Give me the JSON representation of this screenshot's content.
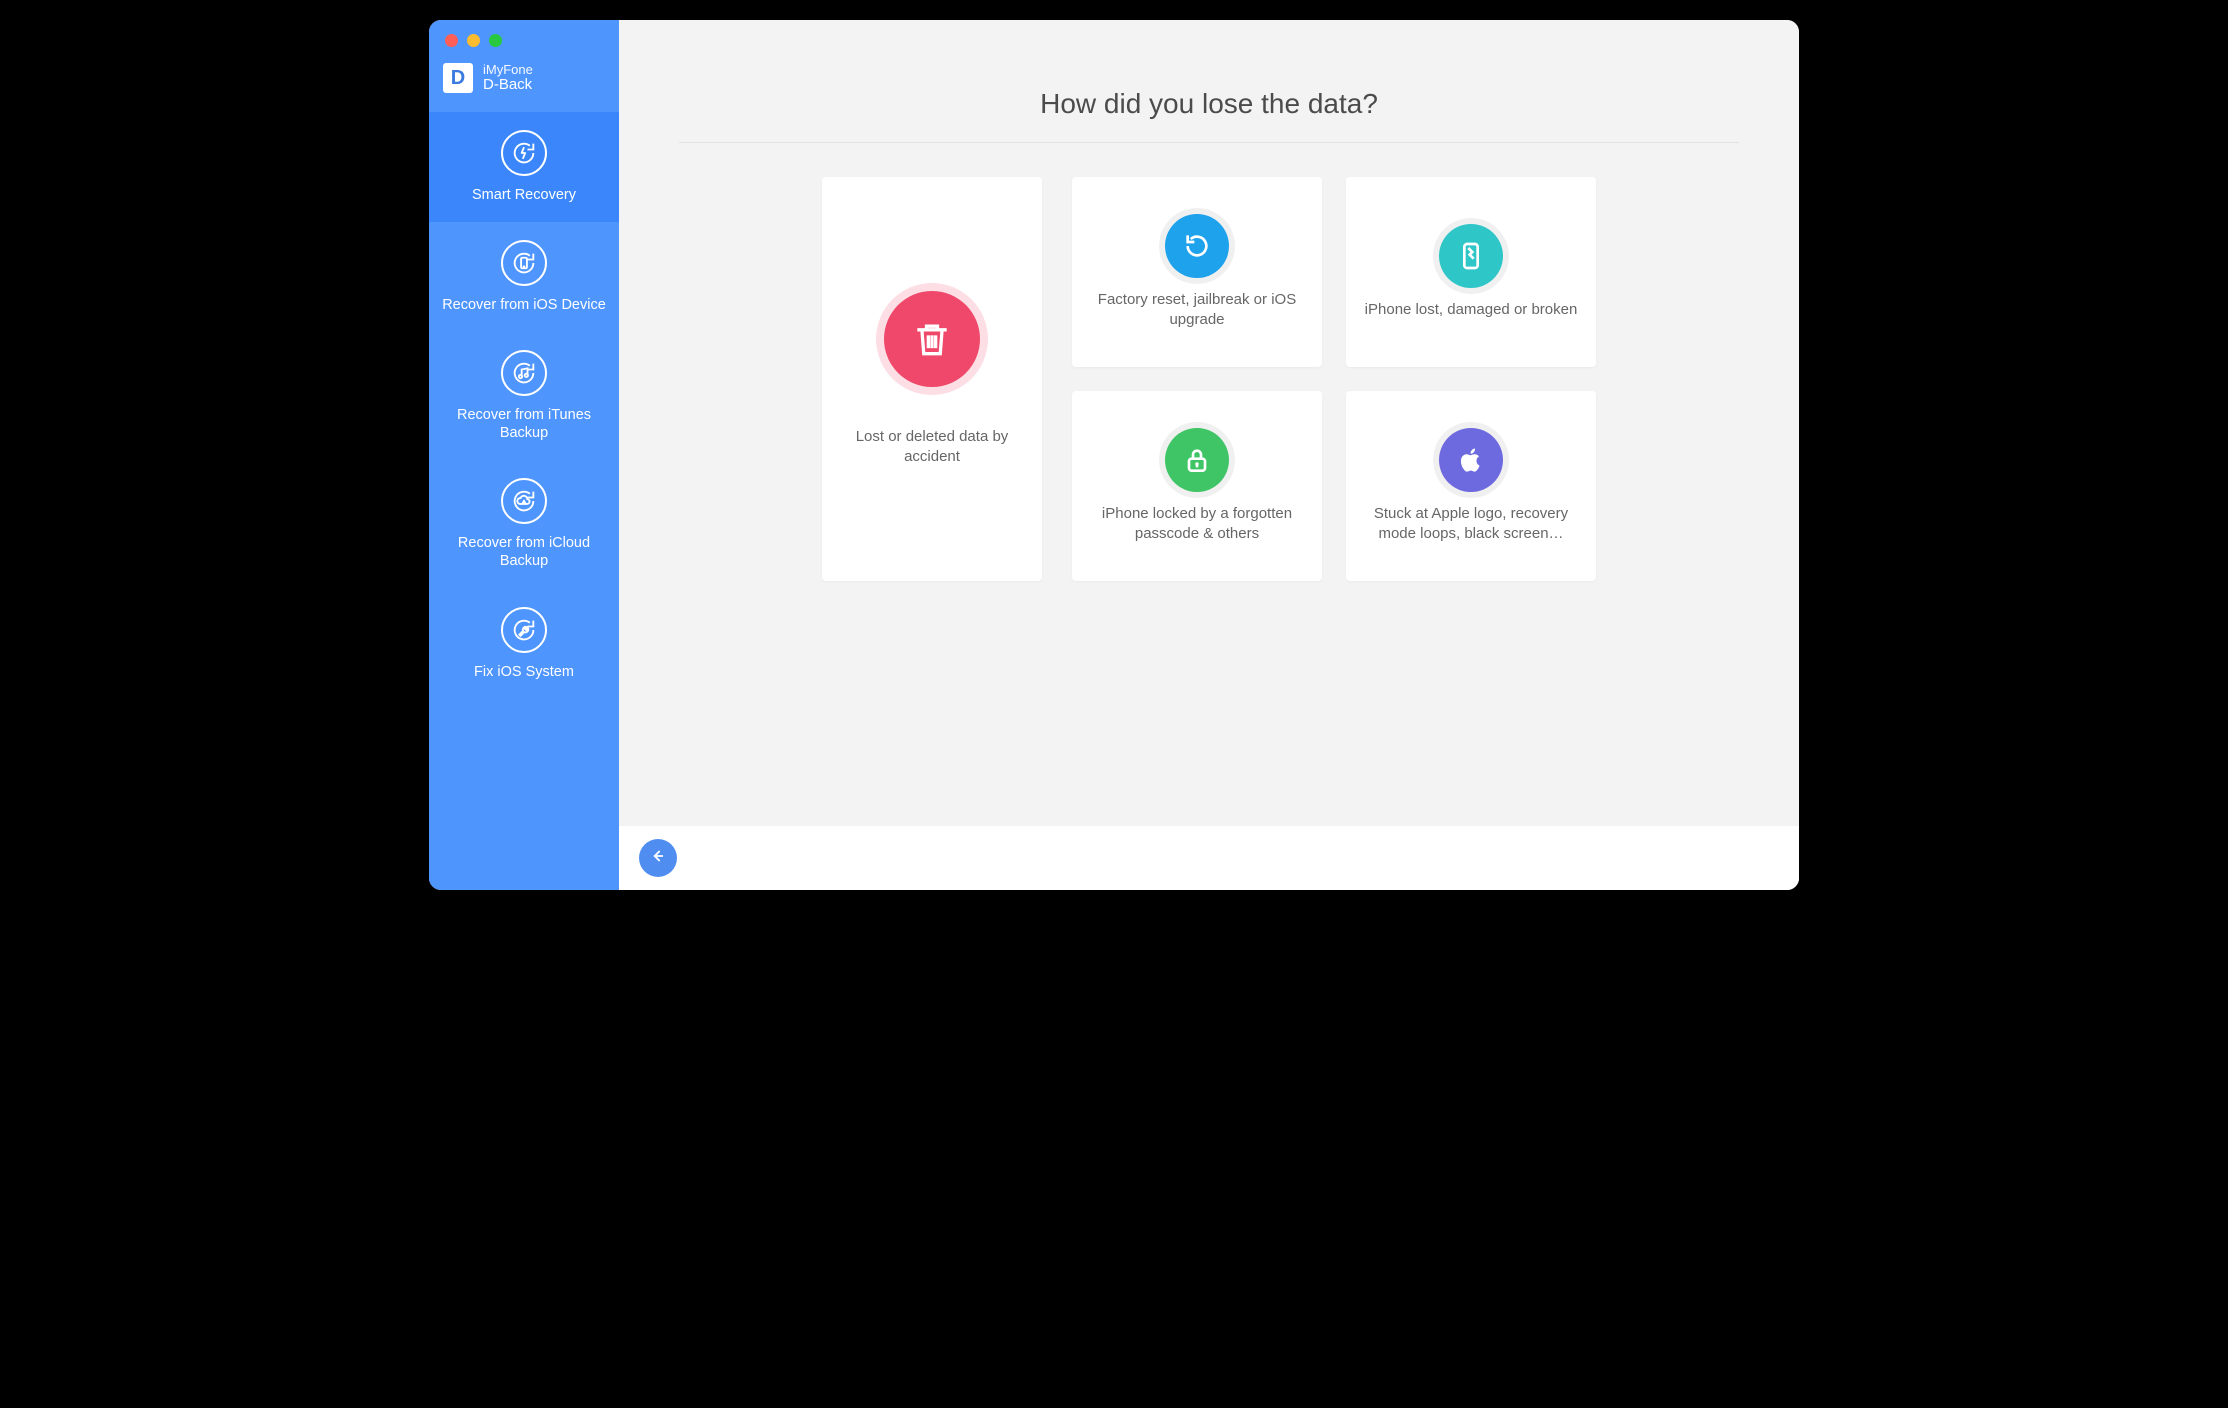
{
  "brand": {
    "company": "iMyFone",
    "product": "D-Back",
    "logo_letter": "D"
  },
  "sidebar": {
    "items": [
      {
        "label": "Smart Recovery"
      },
      {
        "label": "Recover from iOS Device"
      },
      {
        "label": "Recover from iTunes Backup"
      },
      {
        "label": "Recover from iCloud Backup"
      },
      {
        "label": "Fix iOS System"
      }
    ]
  },
  "main": {
    "heading": "How did you lose the data?",
    "cards": {
      "accident": "Lost or deleted data by accident",
      "factory_reset": "Factory reset, jailbreak or iOS upgrade",
      "lost_damaged": "iPhone lost, damaged or broken",
      "locked": "iPhone locked by a forgotten passcode & others",
      "stuck": "Stuck at Apple logo, recovery mode loops, black screen…"
    }
  },
  "colors": {
    "sidebar": "#4f95fe",
    "pink": "#ef486a",
    "blue": "#1fa2ec",
    "teal": "#2fc6c8",
    "green": "#3fc565",
    "purple": "#6d6adf"
  }
}
